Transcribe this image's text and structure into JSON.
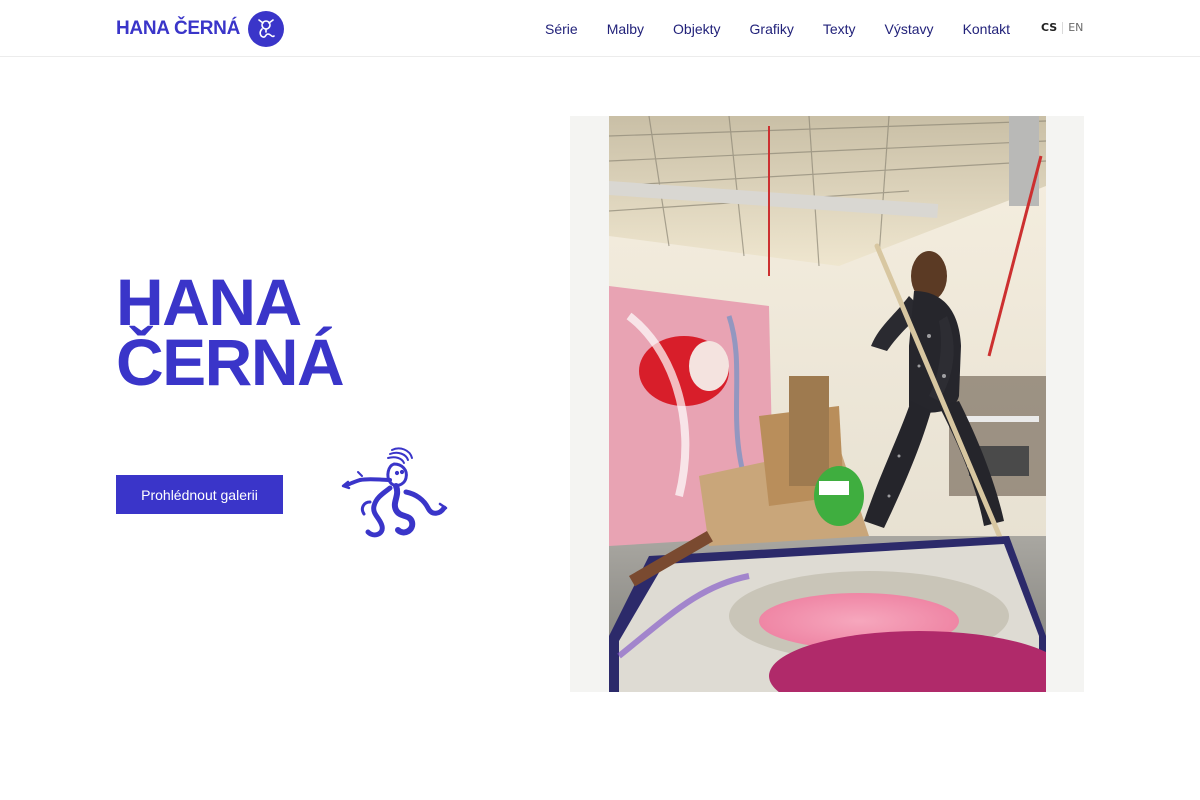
{
  "header": {
    "logo_text": "HANA ČERNÁ",
    "logo_icon": "dragon-badge-icon",
    "nav": [
      {
        "label": "Série"
      },
      {
        "label": "Malby"
      },
      {
        "label": "Objekty"
      },
      {
        "label": "Grafiky"
      },
      {
        "label": "Texty"
      },
      {
        "label": "Výstavy"
      },
      {
        "label": "Kontakt"
      }
    ],
    "lang": {
      "active": "CS",
      "other": "EN"
    }
  },
  "hero": {
    "title_line1": "HANA",
    "title_line2": "ČERNÁ",
    "cta_label": "Prohlédnout galerii",
    "mascot_icon": "dragon-illustration-icon"
  },
  "photo": {
    "subject": "artist-painting-in-studio-photo"
  },
  "colors": {
    "brand": "#3a35c9",
    "nav_text": "#22227a",
    "photo_frame_bg": "#f4f4f2"
  }
}
